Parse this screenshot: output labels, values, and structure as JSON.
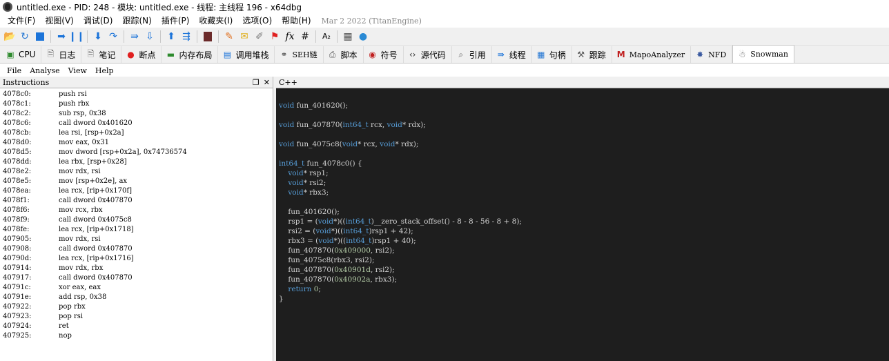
{
  "window": {
    "title": "untitled.exe - PID: 248 - 模块: untitled.exe - 线程: 主线程 196 - x64dbg"
  },
  "menu": {
    "items": [
      "文件(F)",
      "视图(V)",
      "调试(D)",
      "跟踪(N)",
      "插件(P)",
      "收藏夹(I)",
      "选项(O)",
      "帮助(H)"
    ],
    "date": "Mar 2 2022 (TitanEngine)"
  },
  "tabs": [
    {
      "label": "CPU",
      "icon": "cpu-icon"
    },
    {
      "label": "日志",
      "icon": "log-icon"
    },
    {
      "label": "笔记",
      "icon": "notes-icon"
    },
    {
      "label": "断点",
      "icon": "breakpoint-icon"
    },
    {
      "label": "内存布局",
      "icon": "memory-icon"
    },
    {
      "label": "调用堆栈",
      "icon": "callstack-icon"
    },
    {
      "label": "SEH链",
      "icon": "seh-icon"
    },
    {
      "label": "脚本",
      "icon": "script-icon"
    },
    {
      "label": "符号",
      "icon": "symbol-icon"
    },
    {
      "label": "源代码",
      "icon": "source-icon"
    },
    {
      "label": "引用",
      "icon": "references-icon"
    },
    {
      "label": "线程",
      "icon": "threads-icon"
    },
    {
      "label": "句柄",
      "icon": "handles-icon"
    },
    {
      "label": "跟踪",
      "icon": "trace-icon"
    },
    {
      "label": "MapoAnalyzer",
      "icon": "mapo-icon"
    },
    {
      "label": "NFD",
      "icon": "nfd-icon"
    },
    {
      "label": "Snowman",
      "icon": "snowman-icon"
    }
  ],
  "submenu": [
    "File",
    "Analyse",
    "View",
    "Help"
  ],
  "left_pane": {
    "title": "Instructions",
    "instructions": [
      {
        "addr": "4078c0:",
        "text": "push rsi"
      },
      {
        "addr": "4078c1:",
        "text": "push rbx"
      },
      {
        "addr": "4078c2:",
        "text": "sub rsp, 0x38"
      },
      {
        "addr": "4078c6:",
        "text": "call dword 0x401620"
      },
      {
        "addr": "4078cb:",
        "text": "lea rsi, [rsp+0x2a]"
      },
      {
        "addr": "4078d0:",
        "text": "mov eax, 0x31"
      },
      {
        "addr": "4078d5:",
        "text": "mov dword [rsp+0x2a], 0x74736574"
      },
      {
        "addr": "4078dd:",
        "text": "lea rbx, [rsp+0x28]"
      },
      {
        "addr": "4078e2:",
        "text": "mov rdx, rsi"
      },
      {
        "addr": "4078e5:",
        "text": "mov [rsp+0x2e], ax"
      },
      {
        "addr": "4078ea:",
        "text": "lea rcx, [rip+0x170f]"
      },
      {
        "addr": "4078f1:",
        "text": "call dword 0x407870"
      },
      {
        "addr": "4078f6:",
        "text": "mov rcx, rbx"
      },
      {
        "addr": "4078f9:",
        "text": "call dword 0x4075c8"
      },
      {
        "addr": "4078fe:",
        "text": "lea rcx, [rip+0x1718]"
      },
      {
        "addr": "407905:",
        "text": "mov rdx, rsi"
      },
      {
        "addr": "407908:",
        "text": "call dword 0x407870"
      },
      {
        "addr": "40790d:",
        "text": "lea rcx, [rip+0x1716]"
      },
      {
        "addr": "407914:",
        "text": "mov rdx, rbx"
      },
      {
        "addr": "407917:",
        "text": "call dword 0x407870"
      },
      {
        "addr": "40791c:",
        "text": "xor eax, eax"
      },
      {
        "addr": "40791e:",
        "text": "add rsp, 0x38"
      },
      {
        "addr": "407922:",
        "text": "pop rbx"
      },
      {
        "addr": "407923:",
        "text": "pop rsi"
      },
      {
        "addr": "407924:",
        "text": "ret"
      },
      {
        "addr": "407925:",
        "text": "nop"
      }
    ]
  },
  "right_pane": {
    "title": "C++",
    "code": [
      [
        [
          "kw",
          "void"
        ],
        [
          "t",
          " fun_401620();"
        ]
      ],
      [],
      [
        [
          "kw",
          "void"
        ],
        [
          "t",
          " fun_407870("
        ],
        [
          "kw",
          "int64_t"
        ],
        [
          "t",
          " rcx, "
        ],
        [
          "kw",
          "void"
        ],
        [
          "t",
          "* rdx);"
        ]
      ],
      [],
      [
        [
          "kw",
          "void"
        ],
        [
          "t",
          " fun_4075c8("
        ],
        [
          "kw",
          "void"
        ],
        [
          "t",
          "* rcx, "
        ],
        [
          "kw",
          "void"
        ],
        [
          "t",
          "* rdx);"
        ]
      ],
      [],
      [
        [
          "kw",
          "int64_t"
        ],
        [
          "t",
          " fun_4078c0() {"
        ]
      ],
      [
        [
          "t",
          "    "
        ],
        [
          "kw",
          "void"
        ],
        [
          "t",
          "* rsp1;"
        ]
      ],
      [
        [
          "t",
          "    "
        ],
        [
          "kw",
          "void"
        ],
        [
          "t",
          "* rsi2;"
        ]
      ],
      [
        [
          "t",
          "    "
        ],
        [
          "kw",
          "void"
        ],
        [
          "t",
          "* rbx3;"
        ]
      ],
      [],
      [
        [
          "t",
          "    fun_401620();"
        ]
      ],
      [
        [
          "t",
          "    rsp1 = ("
        ],
        [
          "kw",
          "void"
        ],
        [
          "t",
          "*)(("
        ],
        [
          "kw",
          "int64_t"
        ],
        [
          "t",
          ")__zero_stack_offset() - 8 - 8 - 56 - 8 + 8);"
        ]
      ],
      [
        [
          "t",
          "    rsi2 = ("
        ],
        [
          "kw",
          "void"
        ],
        [
          "t",
          "*)(("
        ],
        [
          "kw",
          "int64_t"
        ],
        [
          "t",
          ")rsp1 + 42);"
        ]
      ],
      [
        [
          "t",
          "    rbx3 = ("
        ],
        [
          "kw",
          "void"
        ],
        [
          "t",
          "*)(("
        ],
        [
          "kw",
          "int64_t"
        ],
        [
          "t",
          ")rsp1 + 40);"
        ]
      ],
      [
        [
          "t",
          "    fun_407870("
        ],
        [
          "num",
          "0x409000"
        ],
        [
          "t",
          ", rsi2);"
        ]
      ],
      [
        [
          "t",
          "    fun_4075c8(rbx3, rsi2);"
        ]
      ],
      [
        [
          "t",
          "    fun_407870("
        ],
        [
          "num",
          "0x40901d"
        ],
        [
          "t",
          ", rsi2);"
        ]
      ],
      [
        [
          "t",
          "    fun_407870("
        ],
        [
          "num",
          "0x40902a"
        ],
        [
          "t",
          ", rbx3);"
        ]
      ],
      [
        [
          "t",
          "    "
        ],
        [
          "kw",
          "return"
        ],
        [
          "t",
          " "
        ],
        [
          "num",
          "0"
        ],
        [
          "t",
          ";"
        ]
      ],
      [
        [
          "t",
          "}"
        ]
      ]
    ]
  },
  "colors": {
    "keyword": "#569cd6",
    "number": "#b5cea8",
    "code_bg": "#1e1e1e",
    "code_text": "#d4d4d4"
  },
  "icons": {
    "toolbar": [
      "open-icon",
      "restart-icon",
      "stop-icon",
      "run-icon",
      "pause-icon",
      "step-into-icon",
      "step-over-icon",
      "trace-into-icon",
      "trace-over-icon",
      "execute-till-return-icon",
      "run-to-user-code-icon",
      "scylla-icon",
      "patch-icon",
      "comment-icon",
      "label-icon",
      "bookmark-icon",
      "function-icon",
      "hash-icon",
      "font-icon",
      "calculator-icon",
      "globe-icon"
    ]
  }
}
